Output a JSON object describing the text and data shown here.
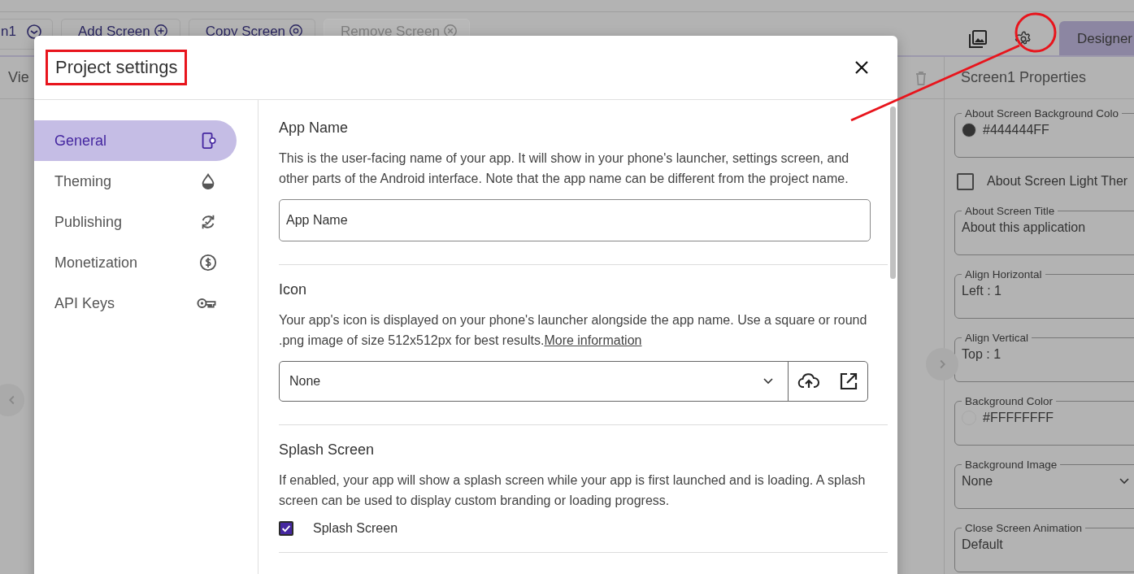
{
  "toolbar": {
    "screen_selector": "n1",
    "buttons": [
      {
        "label": "Add Screen",
        "disabled": false
      },
      {
        "label": "Copy Screen",
        "disabled": false
      },
      {
        "label": "Remove Screen",
        "disabled": true
      }
    ],
    "mode_tab": {
      "label": "Designer",
      "selected": true
    }
  },
  "viewer": {
    "label": "Vie"
  },
  "properties": {
    "title": "Screen1 Properties",
    "items": [
      {
        "kind": "color",
        "label": "About Screen Background Colo",
        "value": "#444444FF",
        "color": "#333333"
      },
      {
        "kind": "checkbox",
        "label": "About Screen Light Ther",
        "checked": false
      },
      {
        "kind": "text",
        "label": "About Screen Title",
        "value": "About this application"
      },
      {
        "kind": "text",
        "label": "Align Horizontal",
        "value": "Left : 1"
      },
      {
        "kind": "text",
        "label": "Align Vertical",
        "value": "Top : 1"
      },
      {
        "kind": "color",
        "label": "Background Color",
        "value": "#FFFFFFFF",
        "color": "#b3b3b3"
      },
      {
        "kind": "select",
        "label": "Background Image",
        "value": "None"
      },
      {
        "kind": "text",
        "label": "Close Screen Animation",
        "value": "Default"
      }
    ]
  },
  "dialog": {
    "title": "Project settings",
    "nav": [
      {
        "label": "General",
        "selected": true
      },
      {
        "label": "Theming",
        "selected": false
      },
      {
        "label": "Publishing",
        "selected": false
      },
      {
        "label": "Monetization",
        "selected": false
      },
      {
        "label": "API Keys",
        "selected": false
      }
    ],
    "sections": [
      {
        "kind": "text_field",
        "heading": "App Name",
        "description": "This is the user-facing name of your app. It will show in your phone's launcher, settings screen, and other parts of the Android interface. Note that the app name can be different from the project name.",
        "placeholder": "App Name"
      },
      {
        "kind": "select",
        "heading": "Icon",
        "description": "Your app's icon is displayed on your phone's launcher alongside the app name. Use a square or round .png image of size 512x512px for best results.",
        "link": "More information",
        "value": "None"
      },
      {
        "kind": "checkbox",
        "heading": "Splash Screen",
        "description": "If enabled, your app will show a splash screen while your app is first launched and is loading. A splash screen can be used to display custom branding or loading progress.",
        "checkbox": {
          "label": "Splash Screen",
          "checked": true
        }
      }
    ]
  }
}
